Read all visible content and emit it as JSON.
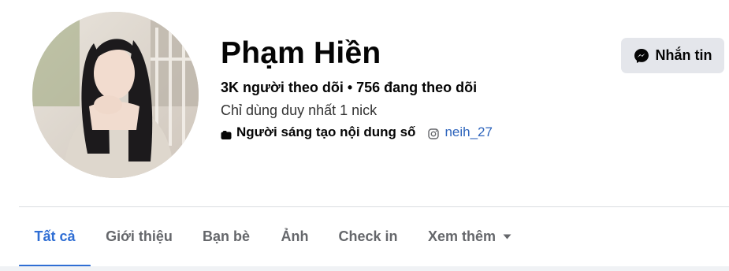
{
  "profile": {
    "name": "Phạm Hiền",
    "stats": "3K người theo dõi • 756 đang theo dõi",
    "bio": "Chỉ dùng duy nhất 1 nick",
    "category": "Người sáng tạo nội dung số",
    "instagram_handle": "neih_27"
  },
  "actions": {
    "message_label": "Nhắn tin"
  },
  "tabs": [
    {
      "label": "Tất cả",
      "active": true
    },
    {
      "label": "Giới thiệu"
    },
    {
      "label": "Bạn bè"
    },
    {
      "label": "Ảnh"
    },
    {
      "label": "Check in"
    },
    {
      "label": "Xem thêm"
    }
  ],
  "colors": {
    "accent": "#2f6ed4",
    "link": "#2d64bc",
    "tab_inactive": "#65676b",
    "button_bg": "#e4e6eb"
  },
  "icons": {
    "category": "video-camera-icon",
    "instagram": "instagram-icon",
    "messenger": "messenger-icon",
    "more": "caret-down-icon"
  }
}
